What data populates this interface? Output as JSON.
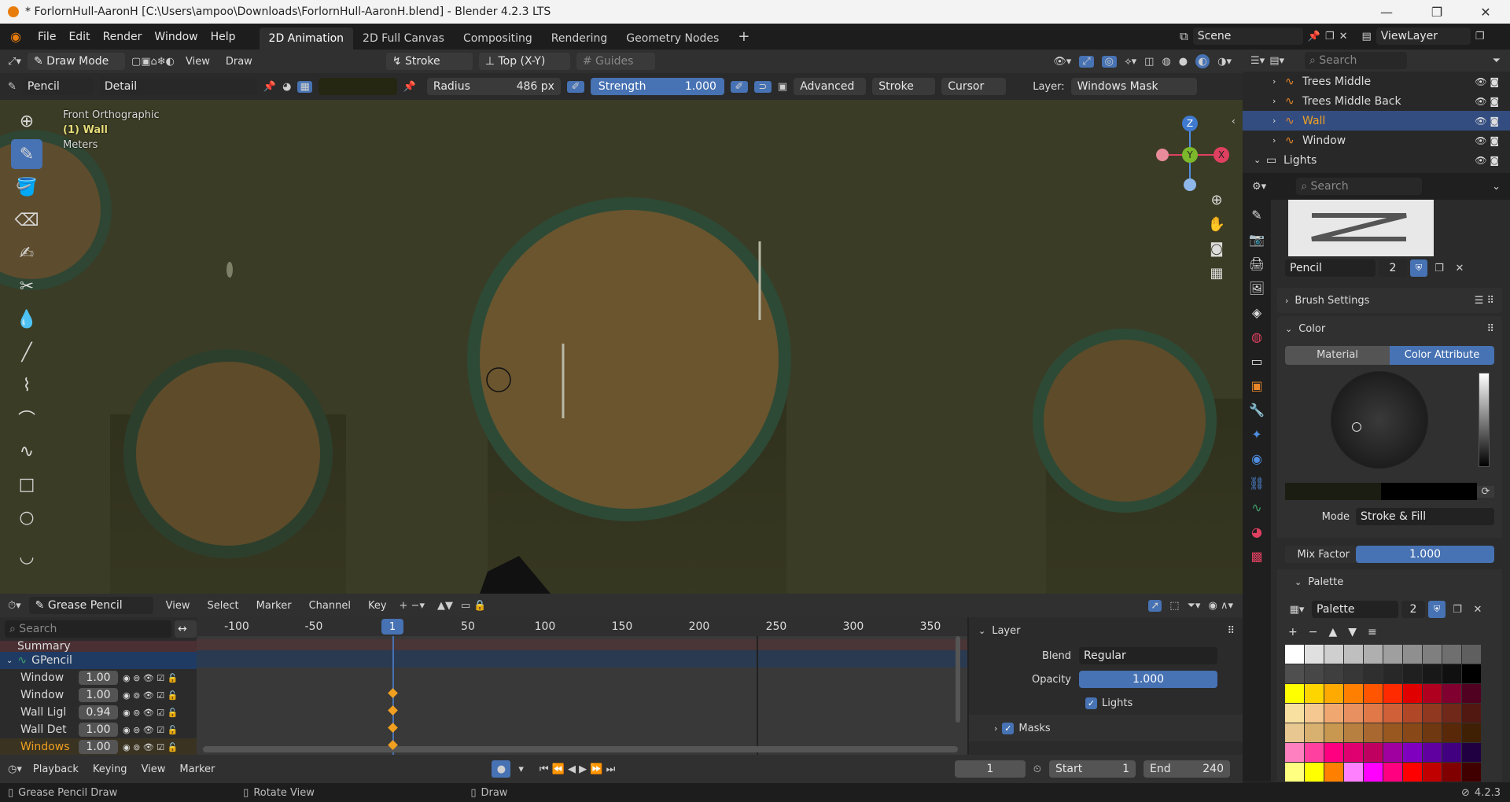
{
  "title_bar": {
    "title": "* ForlornHull-AaronH [C:\\Users\\ampoo\\Downloads\\ForlornHull-AaronH.blend] - Blender 4.2.3 LTS",
    "minimize": "—",
    "maximize": "❐",
    "close": "✕"
  },
  "menu": [
    "File",
    "Edit",
    "Render",
    "Window",
    "Help"
  ],
  "workspaces": [
    "2D Animation",
    "2D Full Canvas",
    "Compositing",
    "Rendering",
    "Geometry Nodes"
  ],
  "workspace_add": "+",
  "scene": {
    "label": "Scene",
    "viewlayer": "ViewLayer"
  },
  "header": {
    "mode": "Draw Mode",
    "view": "View",
    "draw": "Draw",
    "stroke_placement": "Stroke",
    "projection": "Top (X-Y)",
    "guides": "Guides"
  },
  "tool_settings": {
    "brush": "Pencil",
    "brush_preset": "Detail",
    "radius_label": "Radius",
    "radius_value": "486 px",
    "strength_label": "Strength",
    "strength_value": "1.000",
    "advanced": "Advanced",
    "stroke": "Stroke",
    "cursor": "Cursor",
    "layer_label": "Layer:",
    "layer_value": "Windows Mask"
  },
  "viewport_info": {
    "line1": "Front Orthographic",
    "line2": "(1) Wall",
    "line3": "Meters"
  },
  "gizmo": {
    "z": "Z",
    "y": "Y",
    "x": "X"
  },
  "outliner": {
    "search_placeholder": "Search",
    "items": [
      {
        "label": "Trees Middle",
        "active": false
      },
      {
        "label": "Trees Middle Back",
        "active": false
      },
      {
        "label": "Wall",
        "active": true
      },
      {
        "label": "Window",
        "active": false
      },
      {
        "label": "Lights",
        "active": false
      }
    ]
  },
  "properties": {
    "search_placeholder": "Search",
    "brush_name": "Pencil",
    "brush_users": "2",
    "brush_settings": "Brush Settings",
    "color_panel": "Color",
    "tab_material": "Material",
    "tab_color_attribute": "Color Attribute",
    "mode_label": "Mode",
    "mode_value": "Stroke & Fill",
    "mix_factor_label": "Mix Factor",
    "mix_factor_value": "1.000",
    "palette_panel": "Palette",
    "palette_name": "Palette",
    "palette_users": "2"
  },
  "palette_colors": [
    [
      "#ffffff",
      "#e0e0e0",
      "#cfcfcf",
      "#bfbfbf",
      "#afafaf",
      "#9f9f9f",
      "#8f8f8f",
      "#7f7f7f",
      "#6f6f6f",
      "#5f5f5f"
    ],
    [
      "#4f4f4f",
      "#474747",
      "#3f3f3f",
      "#373737",
      "#2f2f2f",
      "#282828",
      "#202020",
      "#181818",
      "#101010",
      "#000000"
    ],
    [
      "#ffff00",
      "#ffd500",
      "#ffaa00",
      "#ff8000",
      "#ff5500",
      "#ff2a00",
      "#e00000",
      "#b00020",
      "#800030",
      "#500020"
    ],
    [
      "#f8e0a0",
      "#f4c890",
      "#f0a870",
      "#e89060",
      "#e07848",
      "#d06038",
      "#b04828",
      "#903820",
      "#702818",
      "#501810"
    ],
    [
      "#e8c890",
      "#d8b070",
      "#c89850",
      "#b88040",
      "#a86830",
      "#985820",
      "#884818",
      "#703810",
      "#582808",
      "#402004"
    ],
    [
      "#ff80c0",
      "#ff40a0",
      "#ff0080",
      "#e00070",
      "#c00060",
      "#a000a0",
      "#8000c0",
      "#6000a0",
      "#400080",
      "#200040"
    ],
    [
      "#ffff80",
      "#ffff00",
      "#ff8000",
      "#ff80ff",
      "#ff00ff",
      "#ff0080",
      "#ff0000",
      "#c00000",
      "#800000",
      "#400000"
    ],
    [
      "#c0e0ff",
      "#80c0ff",
      "#4080ff",
      "#80a0ff",
      "#2060ff",
      "#0040c0",
      "#002080",
      "#001060",
      "#000840",
      "#000020"
    ],
    [
      "#c0ffe0",
      "#80ffc0",
      "#40ff80",
      "#80e0a0",
      "#40c080",
      "#20a060",
      "#108040",
      "#006030",
      "#004020",
      "#002010"
    ]
  ],
  "timeline": {
    "editor": "Grease Pencil",
    "menus": [
      "View",
      "Select",
      "Marker",
      "Channel",
      "Key"
    ],
    "search_placeholder": "Search",
    "summary": "Summary",
    "object": "GPencil",
    "frame_ticks": [
      "-100",
      "-50",
      "1",
      "50",
      "100",
      "150",
      "200",
      "250",
      "300",
      "350"
    ],
    "current_frame": "1",
    "layers": [
      {
        "name": "Window",
        "value": "1.00",
        "color": "#d8d8d8"
      },
      {
        "name": "Window",
        "value": "1.00",
        "color": "#d8d8d8"
      },
      {
        "name": "Wall Ligl",
        "value": "0.94",
        "color": "#d8d8d8"
      },
      {
        "name": "Wall Det",
        "value": "1.00",
        "color": "#d8d8d8"
      },
      {
        "name": "Windows",
        "value": "1.00",
        "color": "#f0a020"
      }
    ]
  },
  "layer_panel": {
    "title": "Layer",
    "blend_label": "Blend",
    "blend_value": "Regular",
    "opacity_label": "Opacity",
    "opacity_value": "1.000",
    "lights": "Lights",
    "masks": "Masks"
  },
  "playback": {
    "playback": "Playback",
    "keying": "Keying",
    "view": "View",
    "marker": "Marker",
    "frame": "1",
    "start_label": "Start",
    "start": "1",
    "end_label": "End",
    "end": "240"
  },
  "status_bar": {
    "left": "Grease Pencil Draw",
    "middle": "Rotate View",
    "right": "Draw",
    "version": "4.2.3"
  },
  "colors": {
    "accent": "#4772b3",
    "active_orange": "#f0a020",
    "viewport_bg": "#3a3b24"
  }
}
